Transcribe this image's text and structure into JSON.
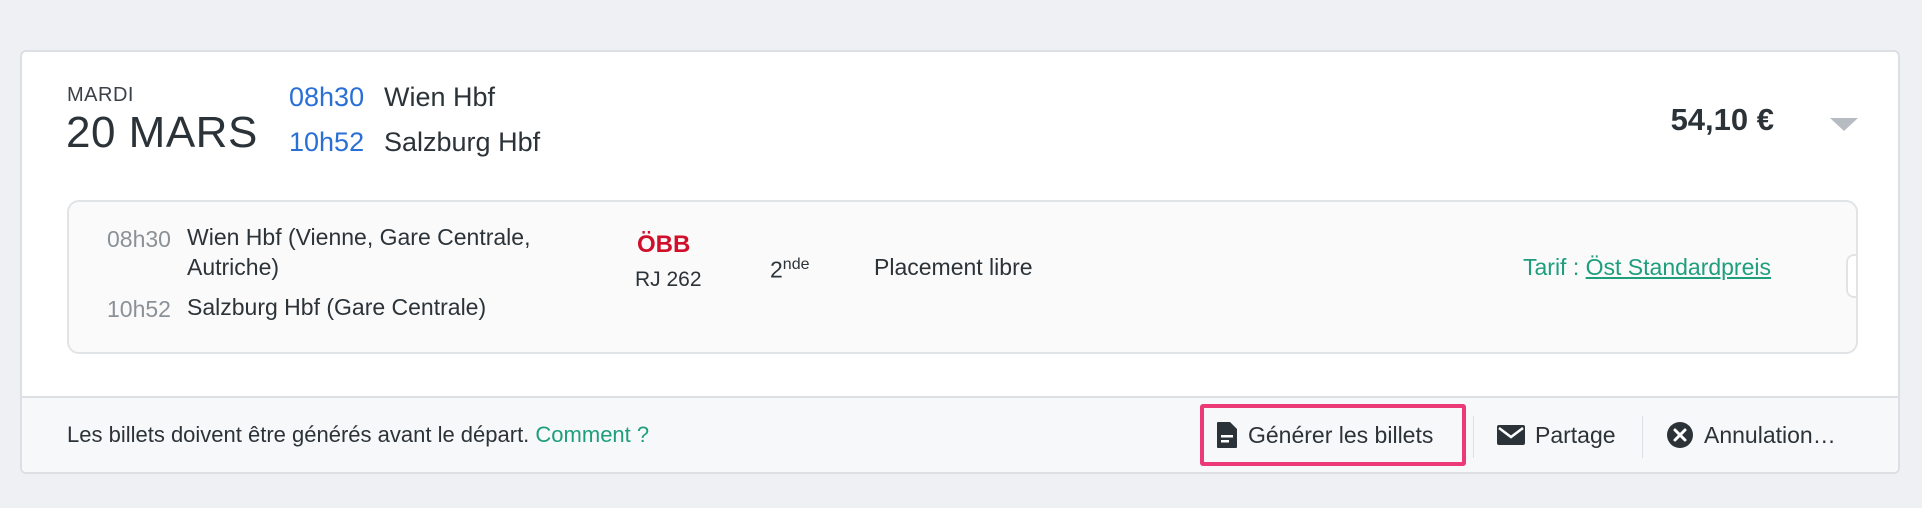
{
  "journey": {
    "date_day": "MARDI",
    "date_main": "20 MARS",
    "departure_time": "08h30",
    "departure_station": "Wien Hbf",
    "arrival_time": "10h52",
    "arrival_station": "Salzburg Hbf",
    "price": "54,10 €"
  },
  "segment": {
    "dep_time": "08h30",
    "dep_station_line1": "Wien Hbf (Vienne, Gare Centrale,",
    "dep_station_line2": "Autriche)",
    "arr_time": "10h52",
    "arr_station": "Salzburg Hbf (Gare Centrale)",
    "operator_logo": "ÖBB",
    "train_code": "RJ 262",
    "class_number": "2",
    "class_suffix": "nde",
    "placement": "Placement libre",
    "tarif_label": "Tarif : ",
    "tarif_link": "Öst Standardpreis"
  },
  "footer": {
    "note": "Les billets doivent être générés avant le départ.",
    "note_link": "Comment ?",
    "generate_label": "Générer les billets",
    "share_label": "Partage",
    "cancel_label": "Annulation…"
  },
  "icons": {
    "generate": "document-icon",
    "share": "envelope-icon",
    "cancel": "close-circle-icon",
    "expand": "chevron-down-icon"
  },
  "colors": {
    "time_blue": "#2a6fd6",
    "accent_green": "#1e9e7d",
    "highlight_pink": "#ec3a77",
    "obb_red": "#d0102b"
  }
}
